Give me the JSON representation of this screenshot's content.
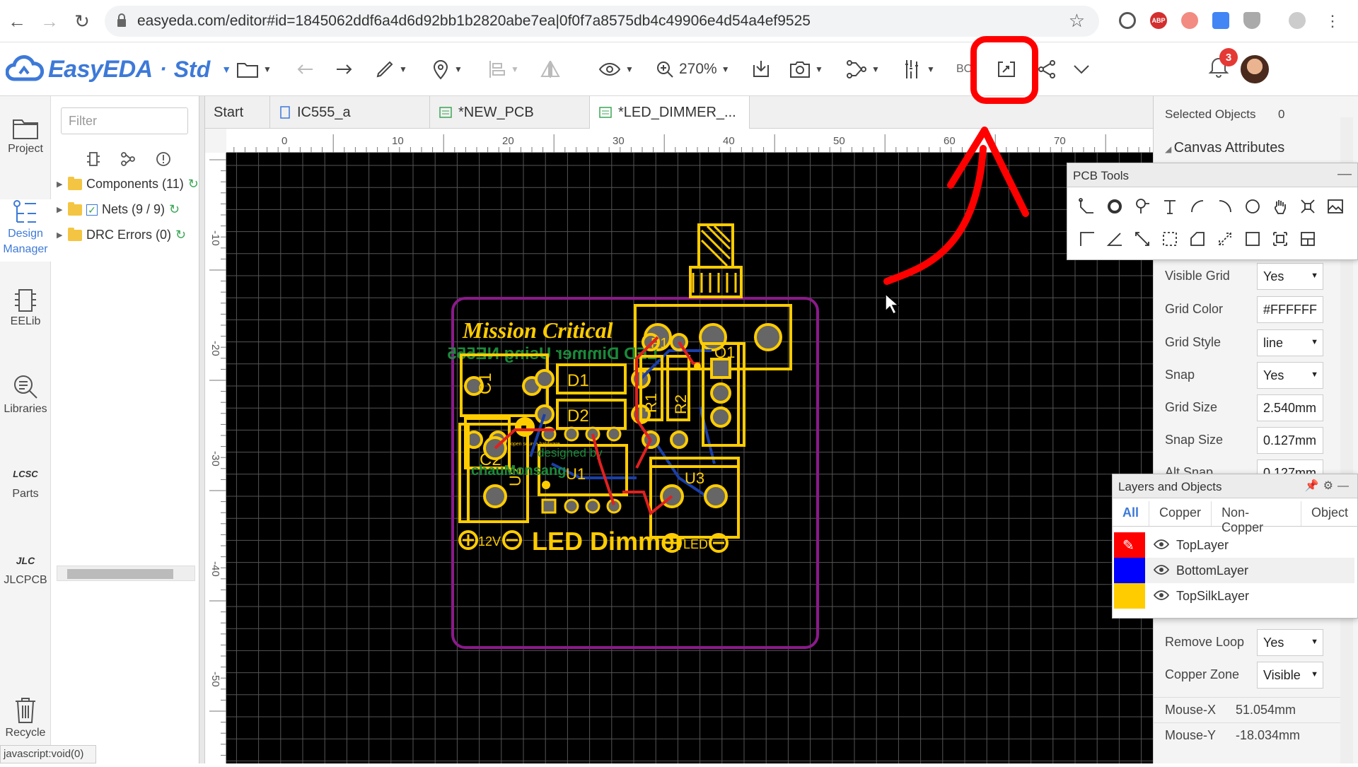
{
  "browser": {
    "url": "easyeda.com/editor#id=1845062ddf6a4d6d92bb1b2820abe7ea|0f0f7a8575db4c49906e4d54a4ef9525",
    "status_text": "javascript:void(0)",
    "ext_abp": "ABP"
  },
  "app": {
    "logo_text": "EasyEDA",
    "logo_separator": "·",
    "edition": "Std",
    "zoom": "270%",
    "bom_label": "BO",
    "notification_count": "3"
  },
  "leftbar": [
    {
      "label": "Project"
    },
    {
      "label": "Design Manager"
    },
    {
      "label": "EELib"
    },
    {
      "label": "Libraries"
    },
    {
      "label": "Parts"
    },
    {
      "label": "JLCPCB"
    },
    {
      "label": "Recycle"
    }
  ],
  "logo_badges": {
    "lcsc": "LCSC",
    "jlc": "JLC"
  },
  "design_manager": {
    "filter_placeholder": "Filter",
    "tree": [
      {
        "label": "Components (11)"
      },
      {
        "label": "Nets (9 / 9)"
      },
      {
        "label": "DRC Errors (0)"
      }
    ]
  },
  "tabs": [
    {
      "label": "Start"
    },
    {
      "label": "IC555_a"
    },
    {
      "label": "*NEW_PCB"
    },
    {
      "label": "*LED_DIMMER_..."
    }
  ],
  "ruler": {
    "top": [
      "0",
      "10",
      "20",
      "30",
      "40",
      "50",
      "60",
      "70"
    ],
    "left": [
      "-10",
      "-20",
      "-30",
      "-40",
      "-50"
    ]
  },
  "board": {
    "title": "Mission Critical",
    "subtitle_mirror": "LED Dimmer Using NE555",
    "footer": "LED Dimmer",
    "designed_by": "designed by",
    "designer": "chauMonsang",
    "osh": "open source hardware",
    "labels": {
      "c1": "C1",
      "c2": "C2",
      "d1": "D1",
      "d2": "D2",
      "r1": "R1",
      "r2": "R2",
      "p1": "P1",
      "q1": "Q1",
      "u1": "U1",
      "u2": "U2",
      "u3": "U3",
      "v12": "12V",
      "led": "LED"
    }
  },
  "right_panel": {
    "selected_label": "Selected Objects",
    "selected_count": "0",
    "canvas_attributes": "Canvas Attributes",
    "rows": [
      {
        "label": "Visible Grid",
        "value": "Yes"
      },
      {
        "label": "Grid Color",
        "value": "#FFFFFF"
      },
      {
        "label": "Grid Style",
        "value": "line"
      },
      {
        "label": "Snap",
        "value": "Yes"
      },
      {
        "label": "Grid Size",
        "value": "2.540mm"
      },
      {
        "label": "Snap Size",
        "value": "0.127mm"
      },
      {
        "label": "Alt Snap",
        "value": "0.127mm"
      },
      {
        "label": "Remove Loop",
        "value": "Yes"
      },
      {
        "label": "Copper Zone",
        "value": "Visible"
      }
    ],
    "mouse_x_label": "Mouse-X",
    "mouse_x": "51.054mm",
    "mouse_y_label": "Mouse-Y",
    "mouse_y": "-18.034mm"
  },
  "pcb_tools": {
    "title": "PCB Tools",
    "tools": [
      "track-icon",
      "pad-icon",
      "via-icon",
      "text-icon",
      "arc-icon",
      "arc-ccw-icon",
      "circle-icon",
      "pan-hand-icon",
      "copper-icon",
      "image-icon",
      "corner-icon",
      "angle-icon",
      "dimension-icon",
      "rect-select-icon",
      "polygon-icon",
      "hole-icon",
      "rectangle-icon",
      "canvas-origin-icon",
      "layout-icon"
    ]
  },
  "layers_panel": {
    "title": "Layers and Objects",
    "tabs": [
      "All",
      "Copper",
      "Non-Copper",
      "Object"
    ],
    "layers": [
      {
        "name": "TopLayer",
        "color": "#FF0000"
      },
      {
        "name": "BottomLayer",
        "color": "#0000FF"
      },
      {
        "name": "TopSilkLayer",
        "color": "#FFCC00"
      }
    ]
  },
  "colors": {
    "accent": "#3d79d8",
    "highlight": "#ff0000",
    "silk": "#ffcc00",
    "outline": "#8b1a8b"
  }
}
